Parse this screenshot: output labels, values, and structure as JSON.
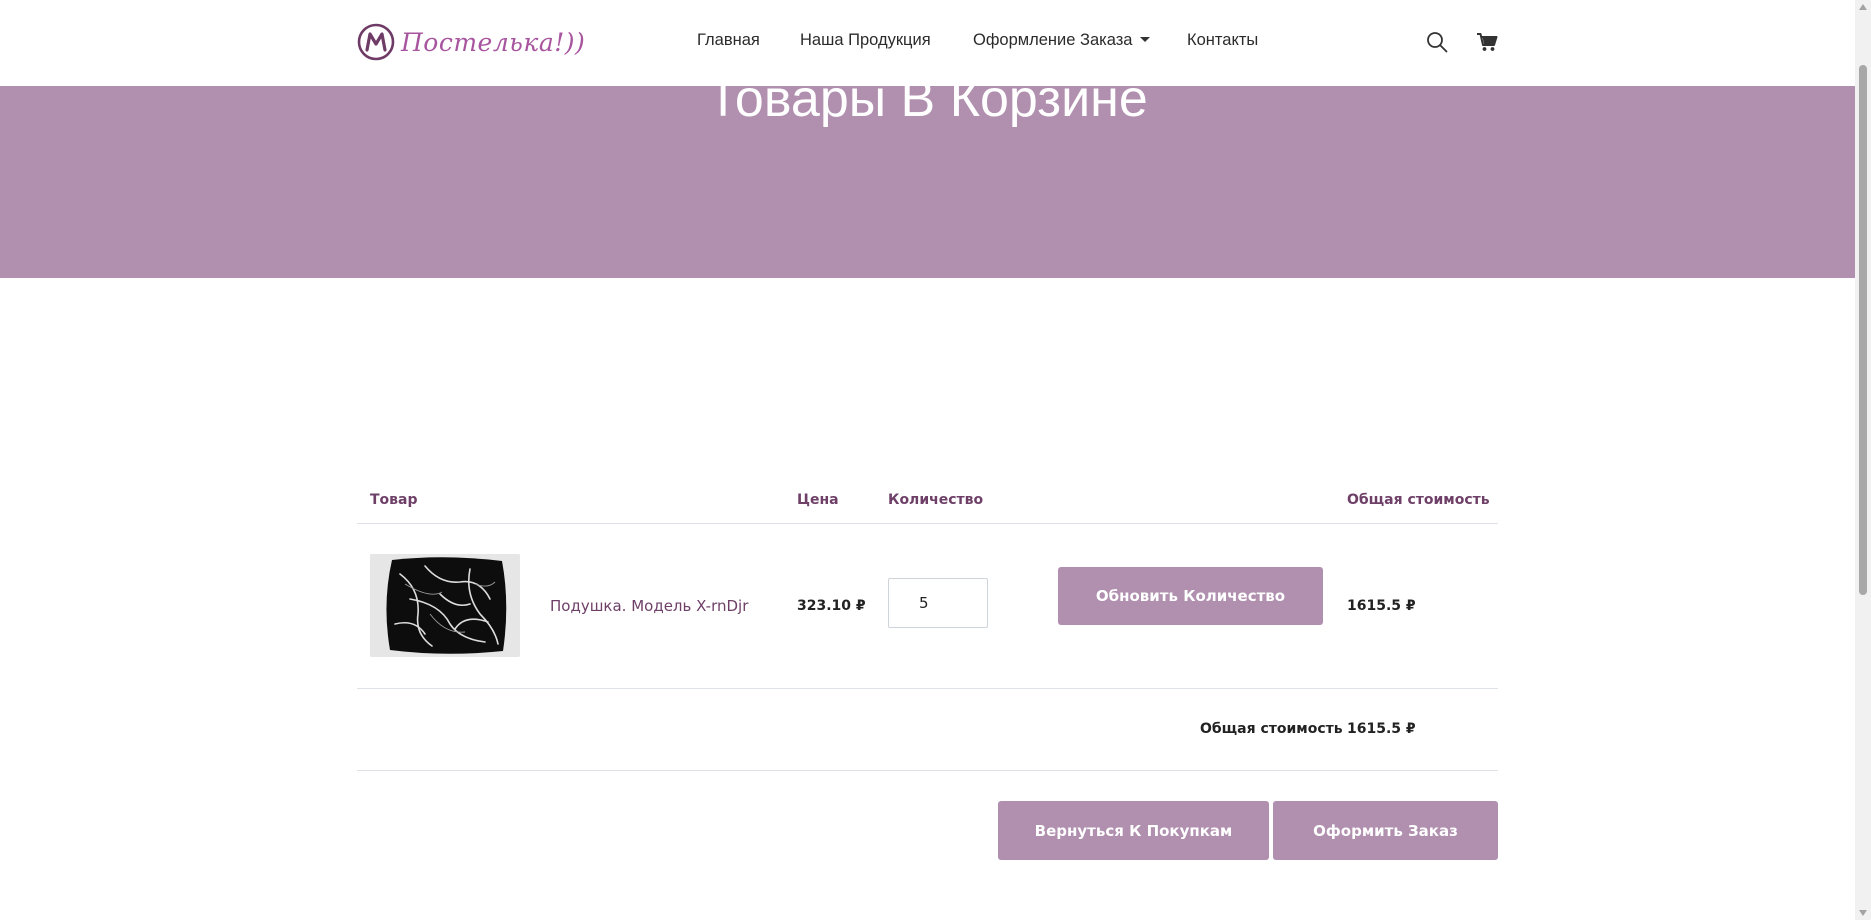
{
  "brand": {
    "name": "Постелька!))",
    "logo_letter": "M",
    "color": "#a8559f"
  },
  "nav": {
    "items": [
      "Главная",
      "Наша Продукция",
      "Оформление Заказа",
      "Контакты"
    ],
    "icons": [
      "search-icon",
      "cart-icon"
    ]
  },
  "hero": {
    "title": "Товары В Корзине",
    "background": "#b08faf"
  },
  "cart": {
    "headers": {
      "product": "Товар",
      "price": "Цена",
      "quantity": "Количество",
      "total": "Общая стоимость"
    },
    "items": [
      {
        "name": "Подушка. Модель X-rnDjr",
        "price": "323.10 ₽",
        "quantity": "5",
        "line_total": "1615.5 ₽"
      }
    ],
    "update_button": "Обновить Количество",
    "total_label": "Общая стоимость",
    "total_value": "1615.5 ₽",
    "continue_button": "Вернуться К Покупкам",
    "checkout_button": "Оформить Заказ"
  },
  "colors": {
    "accent": "#b08faf",
    "header_text": "#6e4068"
  }
}
